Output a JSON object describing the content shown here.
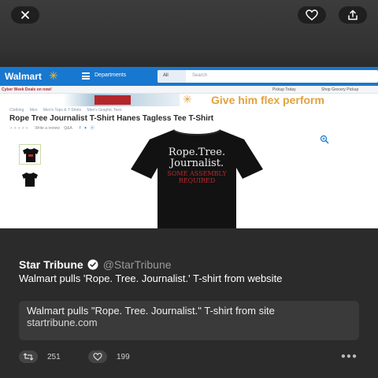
{
  "topbar": {
    "close_icon": "close-icon",
    "like_icon": "heart-icon",
    "share_icon": "share-icon"
  },
  "screenshot": {
    "header": {
      "logo": "Walmart",
      "departments": "Departments",
      "search_scope": "All",
      "search_placeholder": "Search"
    },
    "subbar": {
      "deals": "Cyber Week Deals on now!",
      "pickup": "Pickup Today",
      "grocery": "Shop Grocery Pickup"
    },
    "banner": {
      "text": "Give him flex perform"
    },
    "breadcrumbs": [
      "Clothing",
      "Men",
      "Men's Tops & T-Shirts",
      "Men's Graphic Tees"
    ],
    "product_title": "Rope Tree Journalist T-Shirt Hanes Tagless Tee T-Shirt",
    "rating": {
      "stars": "★★★★★",
      "review_link": "Write a review",
      "qa": "Q&A"
    },
    "shirt_print": {
      "line1": "Rope.Tree.",
      "line2": "Journalist.",
      "line3": "SOME ASSEMBLY",
      "line4": "REQUIRED"
    }
  },
  "tweet": {
    "author": "Star Tribune",
    "handle": "@StarTribune",
    "text": "Walmart pulls 'Rope. Tree. Journalist.' T-shirt from website",
    "card": {
      "title": "Walmart pulls \"Rope. Tree. Journalist.\" T-shirt from site",
      "url": "startribune.com"
    },
    "retweets": "251",
    "likes": "199",
    "more_icon": "more-icon"
  },
  "colors": {
    "walmart_blue": "#1878cf",
    "walmart_yellow": "#ffc220",
    "banner_gold": "#e2a23e",
    "tee_red": "#c0262b",
    "background": "#2b2b2b"
  }
}
